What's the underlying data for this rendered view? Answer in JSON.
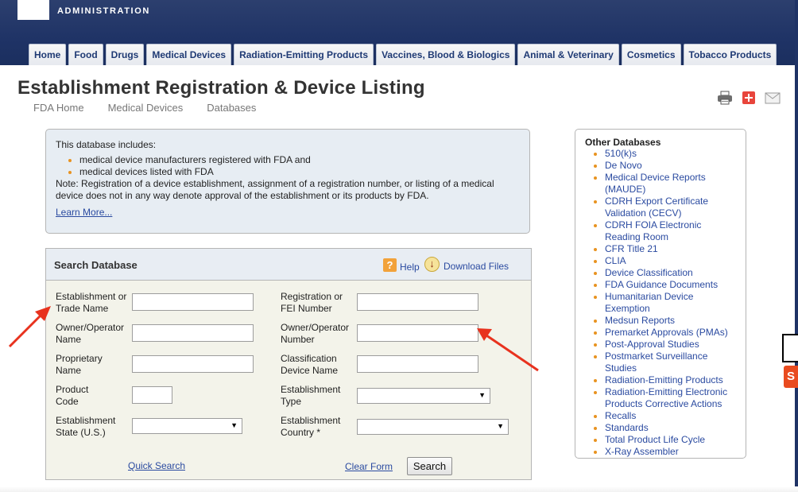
{
  "header": {
    "agency": "ADMINISTRATION",
    "nav": [
      "Home",
      "Food",
      "Drugs",
      "Medical Devices",
      "Radiation-Emitting Products",
      "Vaccines, Blood & Biologics",
      "Animal & Veterinary",
      "Cosmetics",
      "Tobacco Products"
    ]
  },
  "page": {
    "title": "Establishment Registration & Device Listing",
    "breadcrumb": [
      "FDA Home",
      "Medical Devices",
      "Databases"
    ],
    "tools": [
      "print-icon",
      "share-icon",
      "email-icon"
    ]
  },
  "info": {
    "intro": "This database includes:",
    "items": [
      "medical device manufacturers registered with FDA and",
      "medical devices listed with FDA"
    ],
    "note": "Note: Registration of a device establishment, assignment of a registration number, or listing of a medical device does not in any way denote approval of the establishment or its products by FDA.",
    "learn_more": "Learn More..."
  },
  "search": {
    "title": "Search Database",
    "help": "Help",
    "download": "Download Files",
    "fields": {
      "establishment_name": "Establishment or Trade Name",
      "registration_number": "Registration or FEI Number",
      "owner_name": "Owner/Operator Name",
      "owner_number": "Owner/Operator Number",
      "proprietary_name": "Proprietary Name",
      "classification_name": "Classification Device Name",
      "product_code": "Product Code",
      "establishment_type": "Establishment Type",
      "establishment_state": "Establishment State (U.S.)",
      "establishment_country": "Establishment Country *"
    },
    "selects": {
      "establishment_type_value": "",
      "establishment_state_value": "",
      "establishment_country_value": ""
    },
    "quick_search": "Quick Search",
    "clear_form": "Clear Form",
    "search_button": "Search"
  },
  "other_databases": {
    "title": "Other Databases",
    "items": [
      "510(k)s",
      "De Novo",
      "Medical Device Reports (MAUDE)",
      "CDRH Export Certificate Validation (CECV)",
      "CDRH FOIA Electronic Reading Room",
      "CFR Title 21",
      "CLIA",
      "Device Classification",
      "FDA Guidance Documents",
      "Humanitarian Device Exemption",
      "Medsun Reports",
      "Premarket Approvals (PMAs)",
      "Post-Approval Studies",
      "Postmarket Surveillance Studies",
      "Radiation-Emitting Products",
      "Radiation-Emitting Electronic Products Corrective Actions",
      "Recalls",
      "Standards",
      "Total Product Life Cycle",
      "X-Ray Assembler"
    ]
  },
  "colors": {
    "header_bg": "#1f3366",
    "nav_text": "#1f3a74",
    "link": "#2a4aa0",
    "bullet": "#e89320",
    "annotation_arrow": "#e8321e"
  }
}
